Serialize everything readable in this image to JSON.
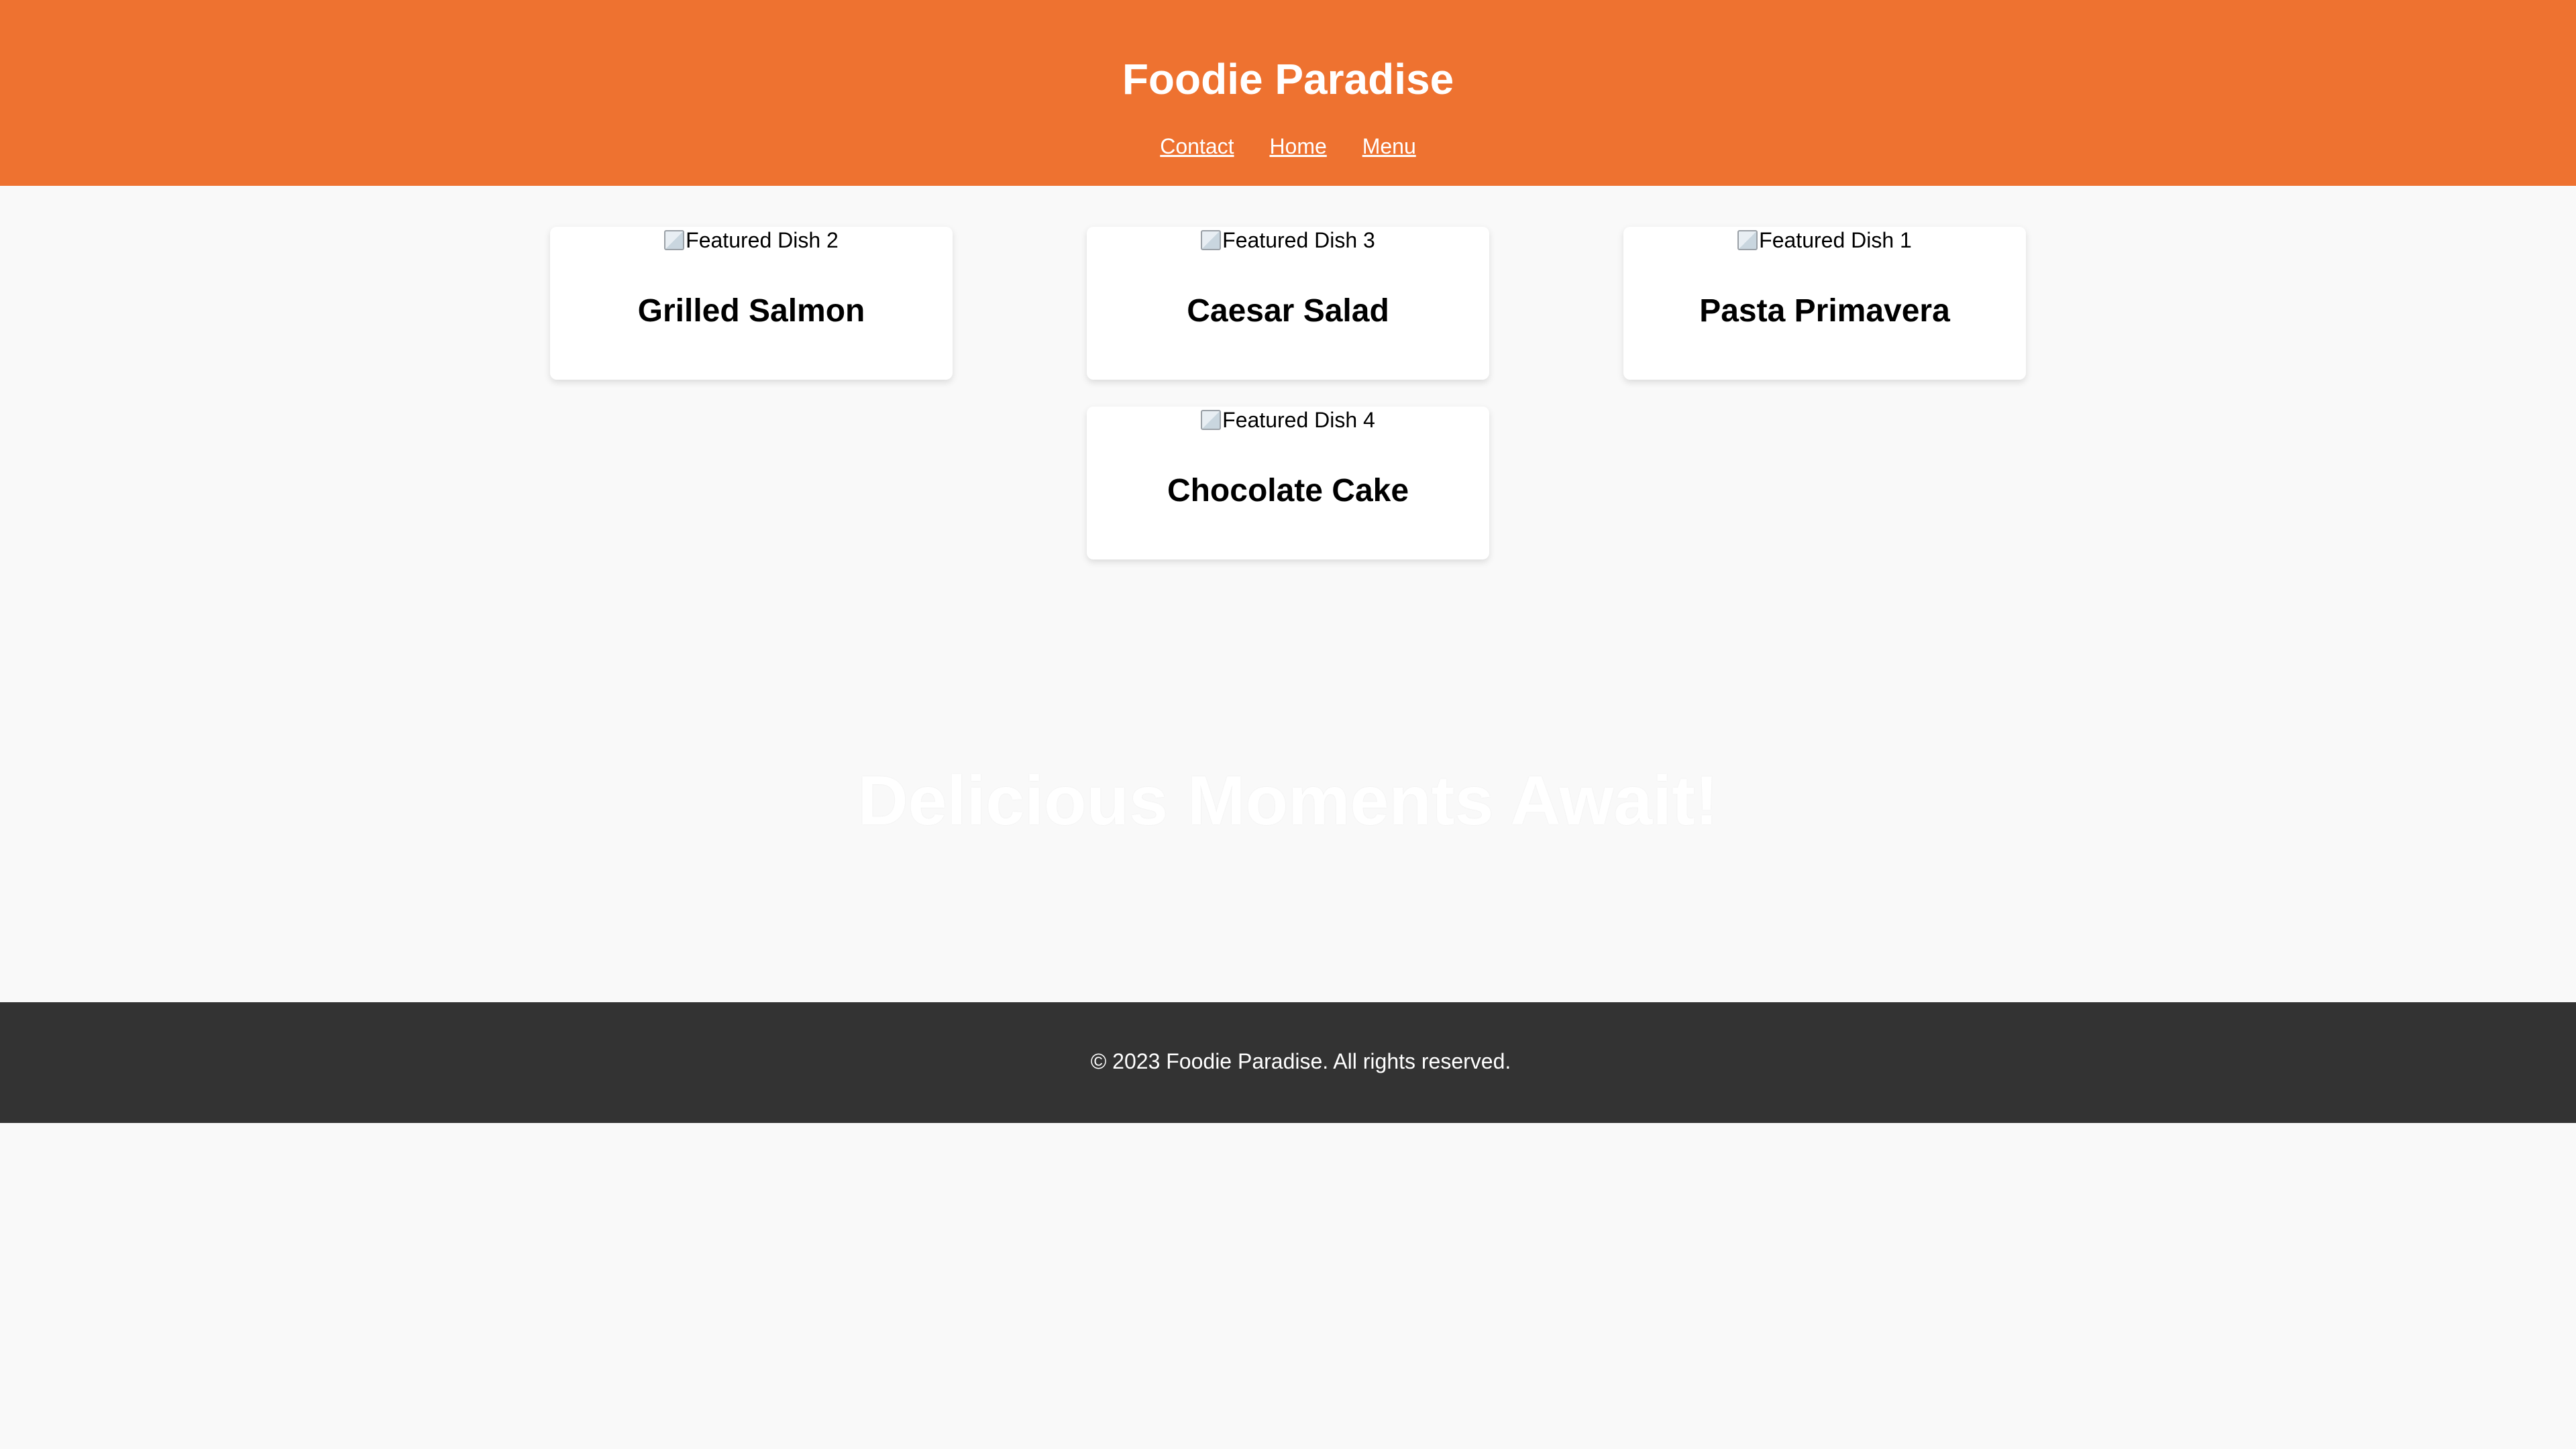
{
  "header": {
    "title": "Foodie Paradise",
    "nav": [
      "Contact",
      "Home",
      "Menu"
    ],
    "background_color": "#ee7230"
  },
  "featured": [
    {
      "image_alt": "Featured Dish 2",
      "name": "Grilled Salmon"
    },
    {
      "image_alt": "Featured Dish 3",
      "name": "Caesar Salad"
    },
    {
      "image_alt": "Featured Dish 1",
      "name": "Pasta Primavera"
    },
    {
      "image_alt": "Featured Dish 4",
      "name": "Chocolate Cake"
    }
  ],
  "hero": {
    "text": "Delicious Moments Await!"
  },
  "footer": {
    "copyright": "© 2023 Foodie Paradise. All rights reserved.",
    "background_color": "#333333"
  }
}
